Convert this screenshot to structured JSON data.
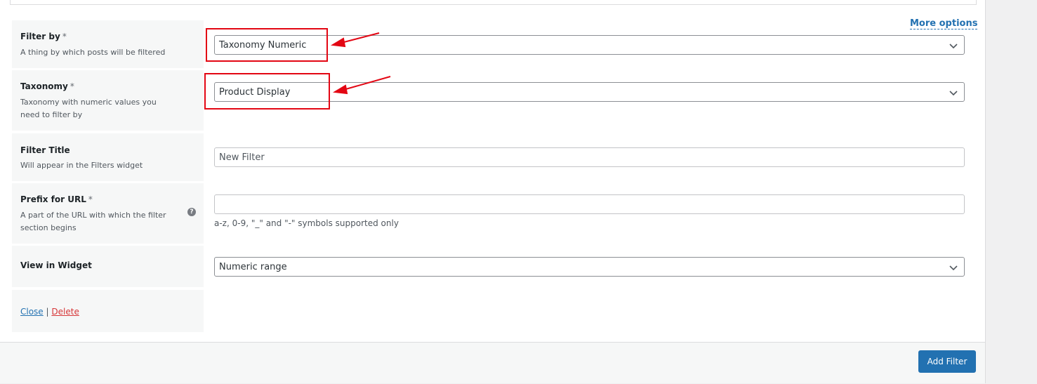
{
  "header": {
    "more_options": "More options"
  },
  "fields": {
    "filter_by": {
      "label": "Filter by",
      "required_mark": "*",
      "description": "A thing by which posts will be filtered",
      "value": "Taxonomy Numeric"
    },
    "taxonomy": {
      "label": "Taxonomy",
      "required_mark": "*",
      "description": "Taxonomy with numeric values you need to filter by",
      "value": "Product Display"
    },
    "filter_title": {
      "label": "Filter Title",
      "description": "Will appear in the Filters widget",
      "placeholder": "New Filter"
    },
    "prefix_url": {
      "label": "Prefix for URL",
      "required_mark": "*",
      "description": "A part of the URL with which the filter section begins",
      "value": "",
      "hint": "a-z, 0-9, \"_\" and \"-\" symbols supported only",
      "help_icon": "?"
    },
    "view_in_widget": {
      "label": "View in Widget",
      "value": "Numeric range"
    }
  },
  "actions": {
    "close": "Close",
    "separator": "|",
    "delete": "Delete",
    "add_filter": "Add Filter"
  },
  "colors": {
    "accent": "#2271b1",
    "delete": "#d63638",
    "annotation": "#e30613"
  }
}
